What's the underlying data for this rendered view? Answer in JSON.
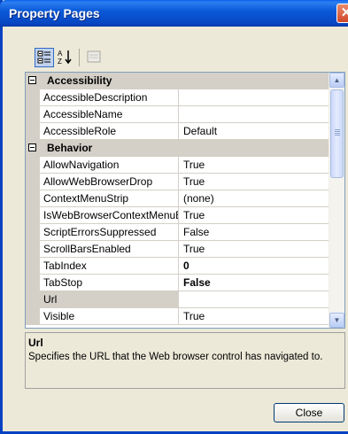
{
  "window": {
    "title": "Property Pages",
    "close_glyph": "✕"
  },
  "toolbar": [
    {
      "icon": "categorized-icon",
      "active": true
    },
    {
      "icon": "alphabetical-icon",
      "glyph": "A",
      "glyph2": "Z",
      "active": false
    },
    {
      "icon": "property-pages-icon",
      "active": false
    }
  ],
  "grid": {
    "categories": [
      {
        "label": "Accessibility",
        "rows": [
          {
            "name": "AccessibleDescription",
            "value": ""
          },
          {
            "name": "AccessibleName",
            "value": ""
          },
          {
            "name": "AccessibleRole",
            "value": "Default"
          }
        ]
      },
      {
        "label": "Behavior",
        "rows": [
          {
            "name": "AllowNavigation",
            "value": "True"
          },
          {
            "name": "AllowWebBrowserDrop",
            "value": "True"
          },
          {
            "name": "ContextMenuStrip",
            "value": "(none)"
          },
          {
            "name": "IsWebBrowserContextMenuEnabled",
            "value": "True"
          },
          {
            "name": "ScriptErrorsSuppressed",
            "value": "False"
          },
          {
            "name": "ScrollBarsEnabled",
            "value": "True"
          },
          {
            "name": "TabIndex",
            "value": "0",
            "bold": true
          },
          {
            "name": "TabStop",
            "value": "False",
            "bold": true
          },
          {
            "name": "Url",
            "value": "",
            "selected": true
          },
          {
            "name": "Visible",
            "value": "True"
          }
        ]
      }
    ]
  },
  "description": {
    "title": "Url",
    "text": "Specifies the URL that the Web browser control has navigated to."
  },
  "buttons": {
    "close_label": "Close"
  }
}
